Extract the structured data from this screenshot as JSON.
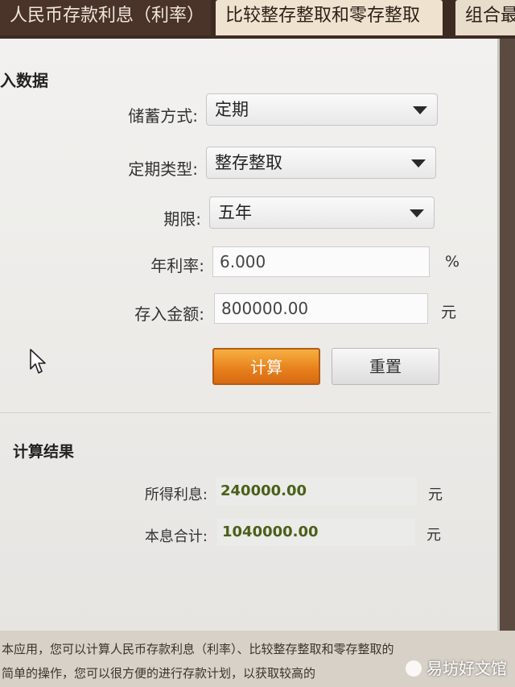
{
  "tabs": [
    {
      "label": "人民币存款利息（利率）"
    },
    {
      "label": "比较整存整取和零存整取"
    },
    {
      "label": "组合最"
    }
  ],
  "input_section": {
    "title": "入数据"
  },
  "form": {
    "saving_method": {
      "label": "储蓄方式:",
      "value": "定期"
    },
    "term_type": {
      "label": "定期类型:",
      "value": "整存整取"
    },
    "period": {
      "label": "期限:",
      "value": "五年"
    },
    "annual_rate": {
      "label": "年利率:",
      "value": "6.000",
      "unit": "%"
    },
    "deposit_amount": {
      "label": "存入金额:",
      "value": "800000.00",
      "unit": "元"
    }
  },
  "buttons": {
    "calculate": "计算",
    "reset": "重置"
  },
  "result_section": {
    "title": "计算结果"
  },
  "results": {
    "interest": {
      "label": "所得利息:",
      "value": "240000.00",
      "unit": "元"
    },
    "total": {
      "label": "本息合计:",
      "value": "1040000.00",
      "unit": "元"
    }
  },
  "footer": {
    "line1": "本应用，您可以计算人民币存款利息（利率）、比较整存整取和零存整取的",
    "line2": "简单的操作，您可以很方便的进行存款计划，以获取较高的"
  },
  "watermark": "易坊好文馆",
  "colors": {
    "calc_button": "#e67f1b",
    "result_text": "#4a6018"
  },
  "icons": {
    "dropdown": "chevron-down-icon",
    "cursor": "mouse-cursor-icon"
  }
}
